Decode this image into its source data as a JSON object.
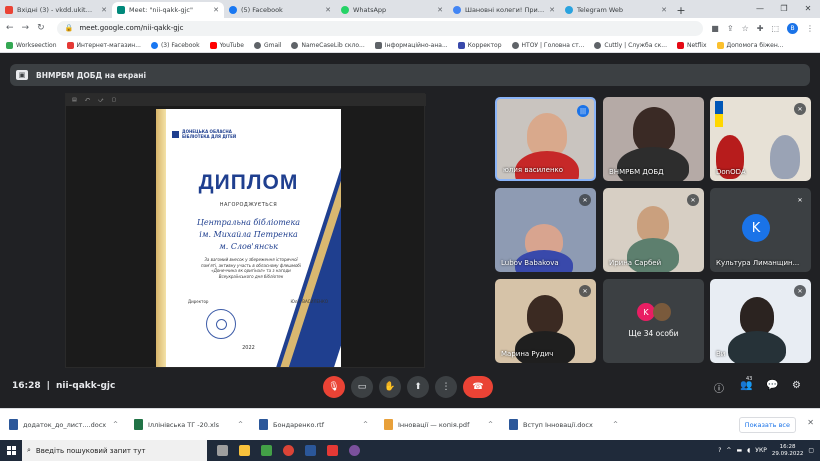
{
  "browser": {
    "tabs": [
      {
        "title": "Вхідні (3) - vkdd.ukit@gmail.com",
        "color": "#ea4335",
        "active": false
      },
      {
        "title": "Meet: \"nii-qakk-gjc\"",
        "color": "#00897b",
        "active": true
      },
      {
        "title": "(5) Facebook",
        "color": "#1877f2",
        "active": false
      },
      {
        "title": "WhatsApp",
        "color": "#25d366",
        "active": false
      },
      {
        "title": "Шановні колеги! Прийміть",
        "color": "#4285f4",
        "active": false
      },
      {
        "title": "Telegram Web",
        "color": "#2aa3df",
        "active": false
      }
    ],
    "url": "meet.google.com/nii-qakk-gjc",
    "profile_initial": "В",
    "bookmarks": [
      "Workseection",
      "Интернет-магазин...",
      "(3) Facebook",
      "YouTube",
      "Gmail",
      "NameCaseLib скло...",
      "Інформаційно-ана...",
      "Корректор",
      "НТОУ | Головна ст...",
      "Cuttly | Служба ск...",
      "Netflix",
      "Допомога біжен..."
    ]
  },
  "meet": {
    "banner": "ВНМРБМ ДОБД на екрані",
    "diploma": {
      "org": "ДОНЕЦЬКА ОБЛАСНА БІБЛІОТЕКА ДЛЯ ДІТЕЙ",
      "title": "ДИПЛОМ",
      "awarded": "НАГОРОДЖУЄТЬСЯ",
      "name1": "Центральна бібліотека",
      "name2": "ім. Михайла Петренка",
      "name3": "м. Слов'янськ",
      "text": "За вагомий внесок у збереження історичної пам'яті, активну участь в обласному флешмобі «Донеччина як оригінал» та з нагоди Всеукраїнського дня бібліотек",
      "director_label": "Директор",
      "director_name": "Юлія ВАСИЛЕНКО",
      "year": "2022"
    },
    "participants": [
      {
        "name": "юлия василенко"
      },
      {
        "name": "ВНМРБМ ДОБД"
      },
      {
        "name": "DonODA"
      },
      {
        "name": "Lubov Babakova"
      },
      {
        "name": "Ирина Сарбей"
      },
      {
        "name": "Культура Лиманщин...",
        "initial": "K"
      },
      {
        "name": "Марина Рудич"
      },
      {
        "name": "Ще 34 особи",
        "initial": "K"
      },
      {
        "name": "Ви"
      }
    ],
    "time": "16:28",
    "meeting_code": "nii-qakk-gjc",
    "people_count": "43"
  },
  "downloads": {
    "items": [
      {
        "name": "додаток_до_лист....docx",
        "color": "#2b579a"
      },
      {
        "name": "Іллінівська ТГ -20.xls",
        "color": "#217346"
      },
      {
        "name": "Бондаренко.rtf",
        "color": "#2b579a"
      },
      {
        "name": "Інновації — копія.pdf",
        "color": "#e8a03a"
      },
      {
        "name": "Вступ Інновації.docx",
        "color": "#2b579a"
      }
    ],
    "show_all": "Показать все"
  },
  "taskbar": {
    "search_placeholder": "Введіть пошуковий запит тут",
    "lang": "УКР",
    "time": "16:28",
    "date": "29.09.2022"
  }
}
